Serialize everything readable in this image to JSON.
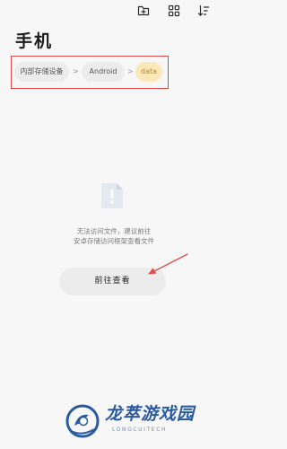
{
  "colors": {
    "background": "#f7f7f7",
    "chip": "#ececec",
    "chip_active": "#fbe8b8",
    "chip_active_text": "#b08a3a",
    "annotation_red": "#e24b4b",
    "watermark_blue": "#2a5ba0"
  },
  "toolbar": {
    "icons": [
      "new-folder-icon",
      "grid-view-icon",
      "sort-icon"
    ]
  },
  "page_title": "手机",
  "breadcrumb": {
    "items": [
      {
        "label": "内部存储设备",
        "active": false
      },
      {
        "label": "Android",
        "active": false
      },
      {
        "label": "data",
        "active": true
      }
    ],
    "separator": ">"
  },
  "empty_state": {
    "icon": "warning-document-icon",
    "message_line1": "无法访问文件，建议前往",
    "message_line2": "安卓存储访问框架查看文件"
  },
  "action_button": {
    "label": "前往查看"
  },
  "watermark": {
    "name": "龙萃游戏园",
    "sub": "LONGCUITECH"
  }
}
